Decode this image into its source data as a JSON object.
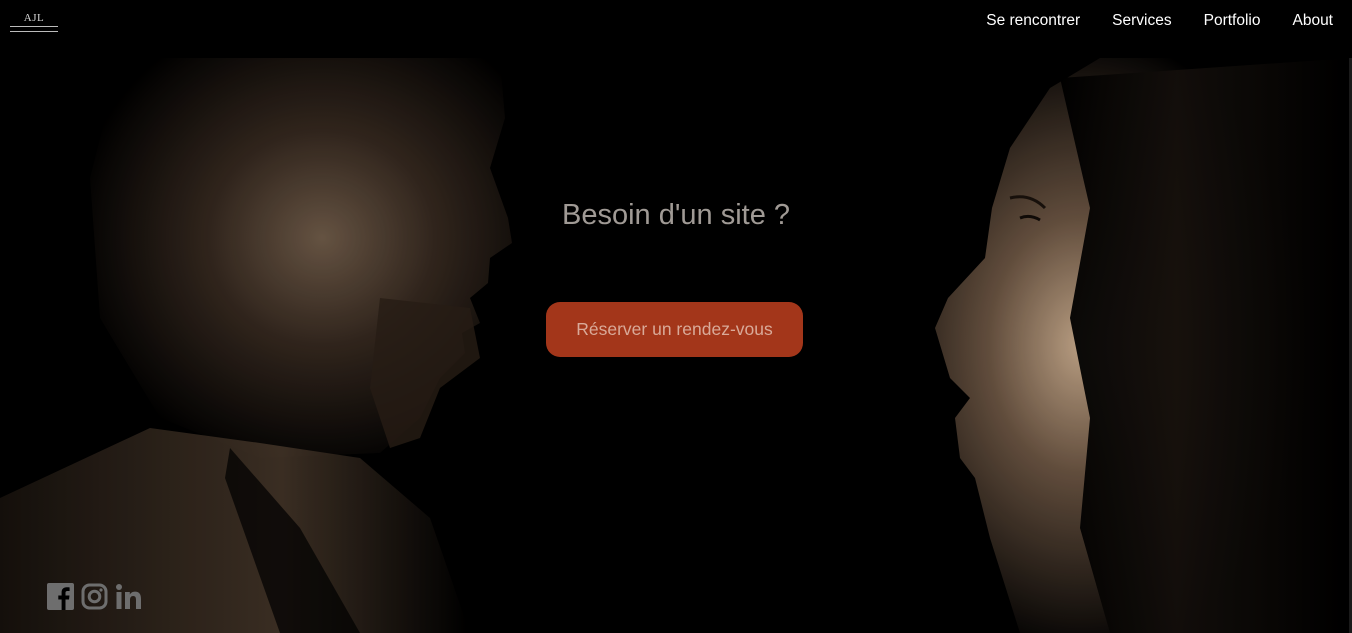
{
  "header": {
    "logo_text": "AJL",
    "nav": [
      {
        "label": "Se rencontrer"
      },
      {
        "label": "Services"
      },
      {
        "label": "Portfolio"
      },
      {
        "label": "About"
      }
    ]
  },
  "hero": {
    "headline": "Besoin d'un site ?",
    "cta_label": "Réserver un rendez-vous"
  },
  "social": [
    {
      "icon": "facebook-icon"
    },
    {
      "icon": "instagram-icon"
    },
    {
      "icon": "linkedin-icon"
    }
  ],
  "colors": {
    "background": "#000000",
    "cta": "#a3361a",
    "cta_text": "#d9aa99",
    "headline": "#a09a95",
    "social_icons": "#6e6e6e"
  }
}
